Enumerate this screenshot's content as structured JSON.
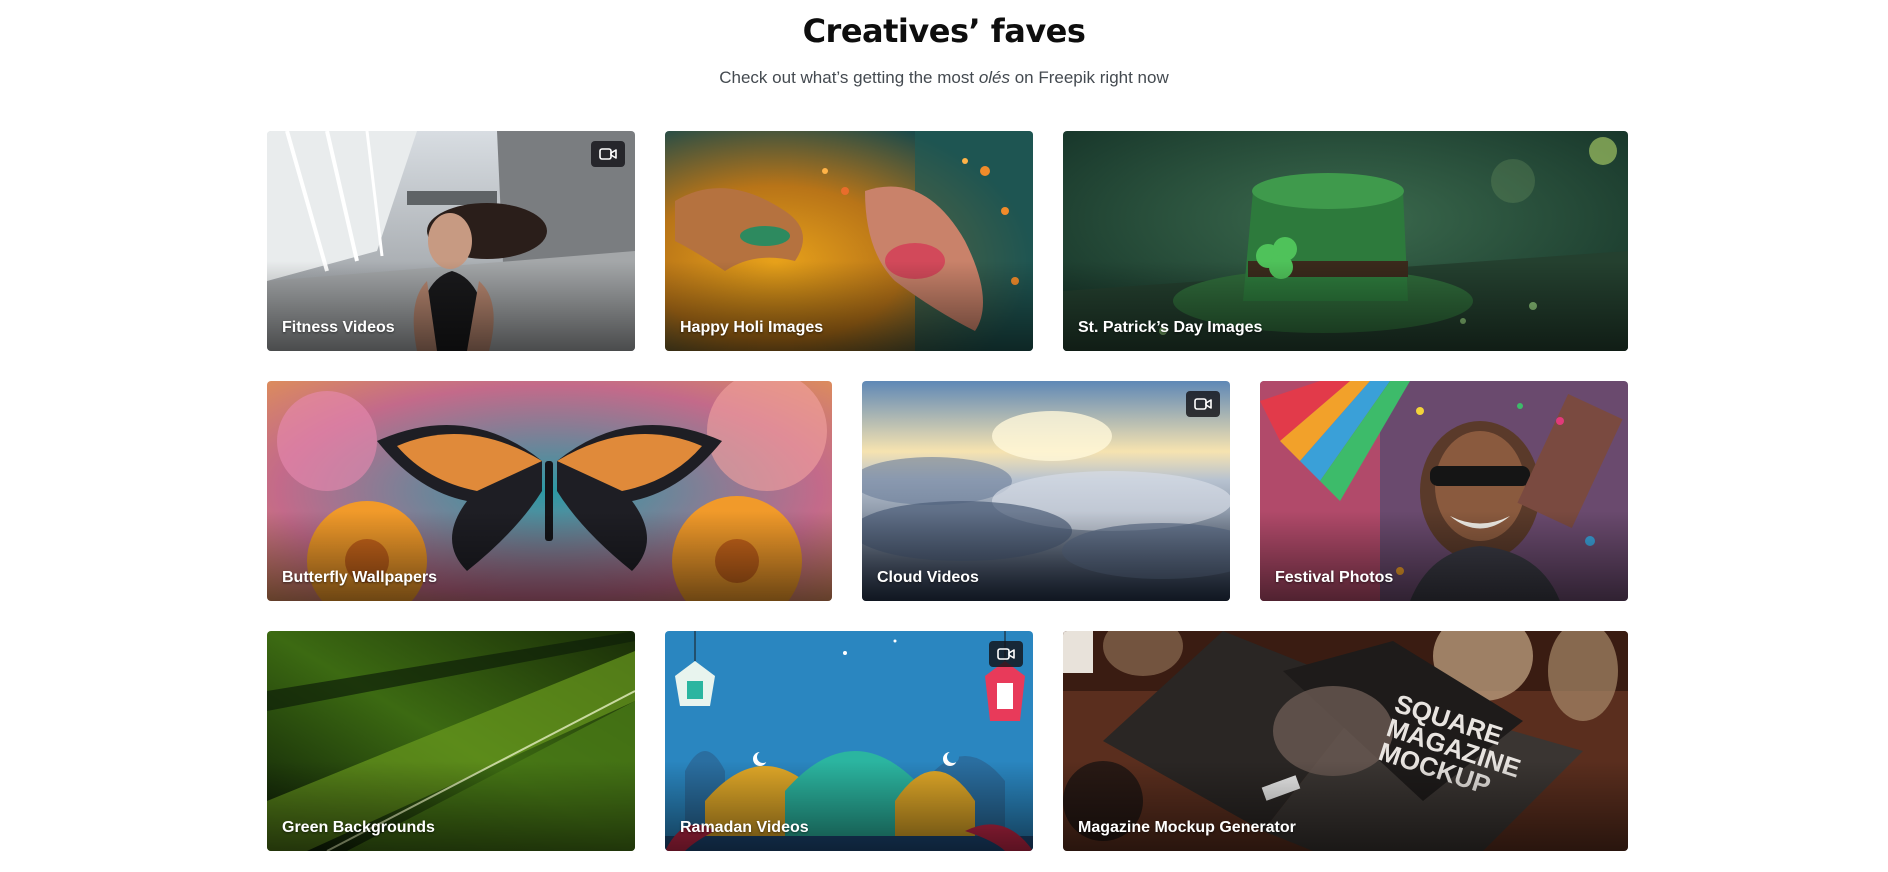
{
  "header": {
    "title": "Creatives’ faves",
    "subtitle_before": "Check out what’s getting the most ",
    "subtitle_emphasis": "olés",
    "subtitle_after": " on Freepik right now"
  },
  "cards": [
    {
      "label": "Fitness Videos",
      "icon": "video-camera-icon"
    },
    {
      "label": "Happy Holi Images"
    },
    {
      "label": "St. Patrick’s Day Images"
    },
    {
      "label": "Butterfly Wallpapers"
    },
    {
      "label": "Cloud Videos",
      "icon": "video-camera-icon"
    },
    {
      "label": "Festival Photos"
    },
    {
      "label": "Green Backgrounds"
    },
    {
      "label": "Ramadan Videos",
      "icon": "video-camera-icon"
    },
    {
      "label": "Magazine Mockup Generator"
    }
  ],
  "mockup_text": {
    "line1": "SQUARE",
    "line2": "MAGAZINE",
    "line3": "MOCKUP"
  }
}
